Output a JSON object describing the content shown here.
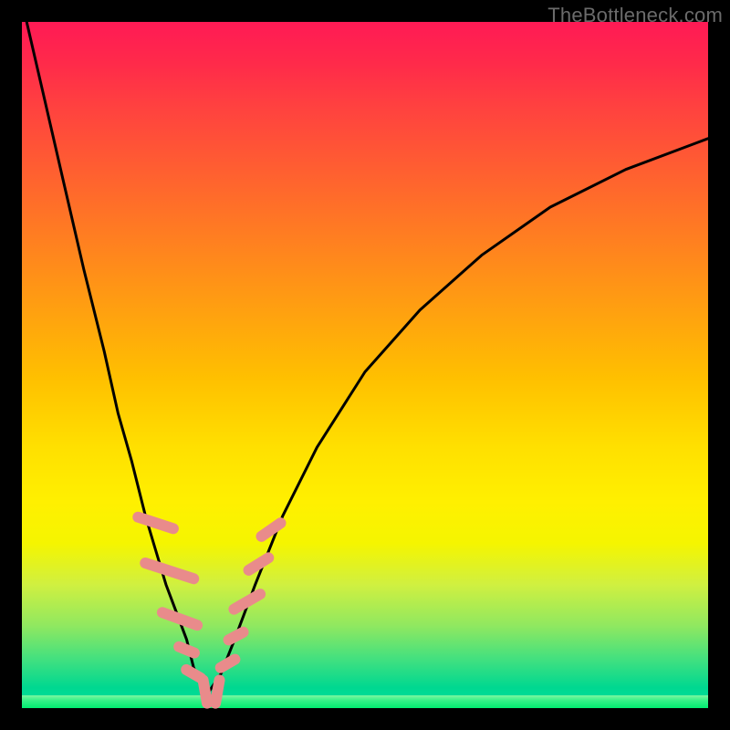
{
  "watermark": "TheBottleneck.com",
  "colors": {
    "frame": "#000000",
    "curve": "#000000",
    "marker_fill": "#e98b8b",
    "marker_stroke": "#d87070",
    "gradient_top": "#ff1a55",
    "gradient_bottom": "#00ec70"
  },
  "chart_data": {
    "type": "line",
    "title": "",
    "xlabel": "",
    "ylabel": "",
    "xlim": [
      0,
      100
    ],
    "ylim": [
      0,
      100
    ],
    "grid": false,
    "legend": false,
    "series": [
      {
        "name": "left-branch",
        "x": [
          0,
          3,
          6,
          9,
          12,
          14,
          16,
          18,
          19.5,
          21,
          22.5,
          24,
          25,
          26,
          27
        ],
        "y": [
          103,
          90,
          77,
          64,
          52,
          43,
          36,
          28,
          23,
          18,
          14,
          10,
          6,
          3.5,
          2
        ]
      },
      {
        "name": "right-branch",
        "x": [
          27,
          29,
          31,
          34,
          38,
          43,
          50,
          58,
          67,
          77,
          88,
          100
        ],
        "y": [
          2,
          5,
          10,
          18,
          28,
          38,
          49,
          58,
          66,
          73,
          78.5,
          83
        ]
      }
    ],
    "markers": {
      "comment": "pink oblong beads clustered near the valley on both branches",
      "shape": "rounded-rect",
      "approx_points": [
        {
          "x": 19.5,
          "y": 27,
          "len": 7,
          "angle": -72
        },
        {
          "x": 21.5,
          "y": 20,
          "len": 9,
          "angle": -72
        },
        {
          "x": 23.0,
          "y": 13,
          "len": 7,
          "angle": -70
        },
        {
          "x": 24.0,
          "y": 8.5,
          "len": 4,
          "angle": -68
        },
        {
          "x": 25.0,
          "y": 5.0,
          "len": 4,
          "angle": -60
        },
        {
          "x": 26.7,
          "y": 2.4,
          "len": 5,
          "angle": -10
        },
        {
          "x": 28.5,
          "y": 2.4,
          "len": 5,
          "angle": 10
        },
        {
          "x": 30.0,
          "y": 6.5,
          "len": 4,
          "angle": 60
        },
        {
          "x": 31.2,
          "y": 10.5,
          "len": 4,
          "angle": 62
        },
        {
          "x": 32.8,
          "y": 15.5,
          "len": 6,
          "angle": 60
        },
        {
          "x": 34.5,
          "y": 21.0,
          "len": 5,
          "angle": 58
        },
        {
          "x": 36.3,
          "y": 26.0,
          "len": 5,
          "angle": 55
        }
      ]
    }
  }
}
